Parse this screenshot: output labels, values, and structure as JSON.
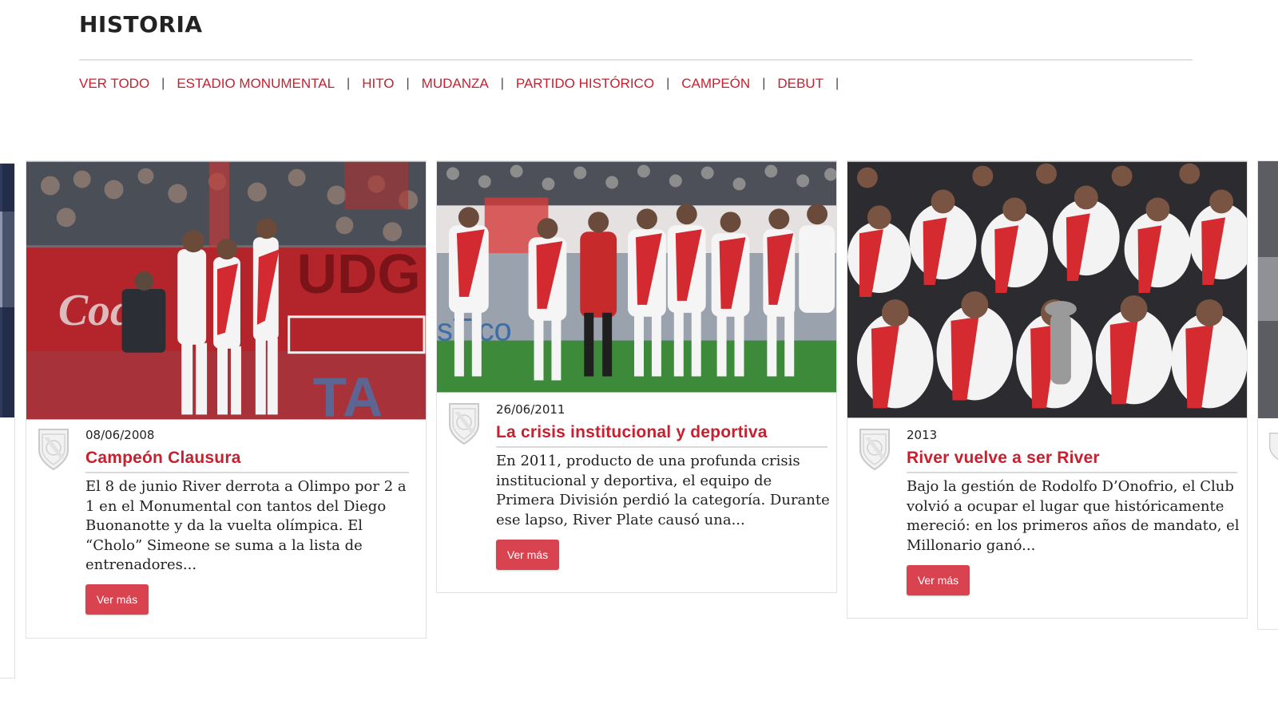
{
  "header": {
    "title": "HISTORIA"
  },
  "filters": [
    {
      "label": "VER TODO"
    },
    {
      "label": "ESTADIO MONUMENTAL"
    },
    {
      "label": "HITO"
    },
    {
      "label": "MUDANZA"
    },
    {
      "label": "PARTIDO HISTÓRICO"
    },
    {
      "label": "CAMPEÓN"
    },
    {
      "label": "DEBUT"
    }
  ],
  "filter_separator": "|",
  "cards": [
    {
      "date": "08/06/2008",
      "title": "Campeón Clausura",
      "excerpt": "El 8 de junio River derrota a Olimpo por 2 a 1 en el Monumental con tantos del Diego Buonanotte y da la vuelta olímpica. El “Cholo” Simeone se suma a la lista de entrenadores...",
      "button": "Ver más"
    },
    {
      "date": "26/06/2011",
      "title": "La crisis institucional y deportiva",
      "excerpt": "En 2011, producto de una profunda crisis institucional y deportiva, el equipo de Primera División perdió la categoría. Durante ese lapso, River Plate causó una...",
      "button": "Ver más"
    },
    {
      "date": "2013",
      "title": "River vuelve a ser River",
      "excerpt": "Bajo la gestión de Rodolfo D’Onofrio, el Club volvió a ocupar el lugar que históricamente mereció: en los primeros años de mandato, el Millonario ganó...",
      "button": "Ver más"
    }
  ],
  "colors": {
    "accent": "#c8202e",
    "button": "#d9434f",
    "text": "#222222",
    "rule": "#d9d9d9"
  }
}
